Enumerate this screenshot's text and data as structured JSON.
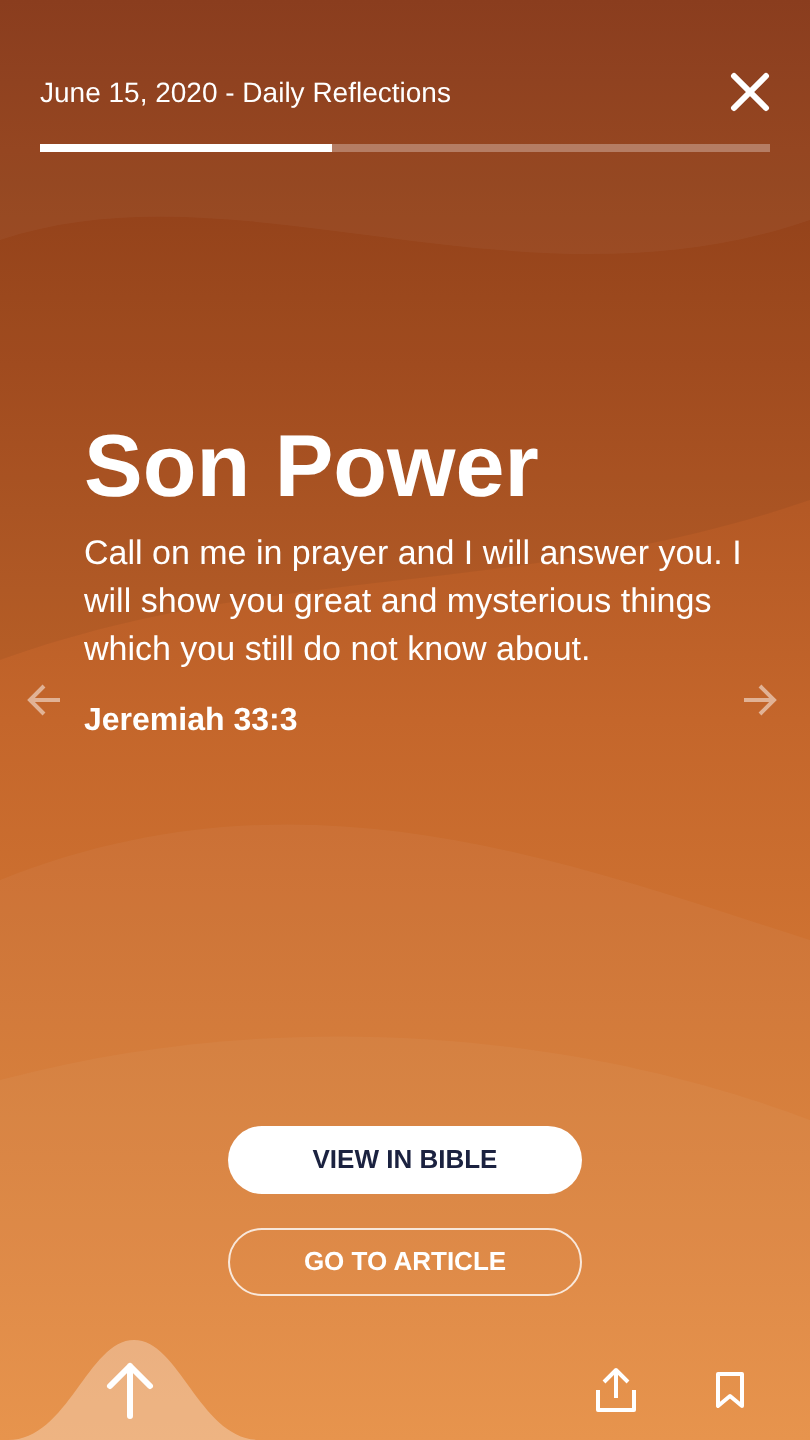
{
  "header": {
    "title": "June 15, 2020 - Daily Reflections"
  },
  "progress": {
    "level": 0.4
  },
  "content": {
    "title": "Son Power",
    "verse": "Call on me in prayer and I will answer you. I will show you great and mysterious things which you still do not know about.",
    "reference": "Jeremiah 33:3"
  },
  "buttons": [
    {
      "label": "VIEW IN BIBLE",
      "kind": "filled"
    },
    {
      "label": "GO TO ARTICLE",
      "kind": "outline"
    }
  ]
}
